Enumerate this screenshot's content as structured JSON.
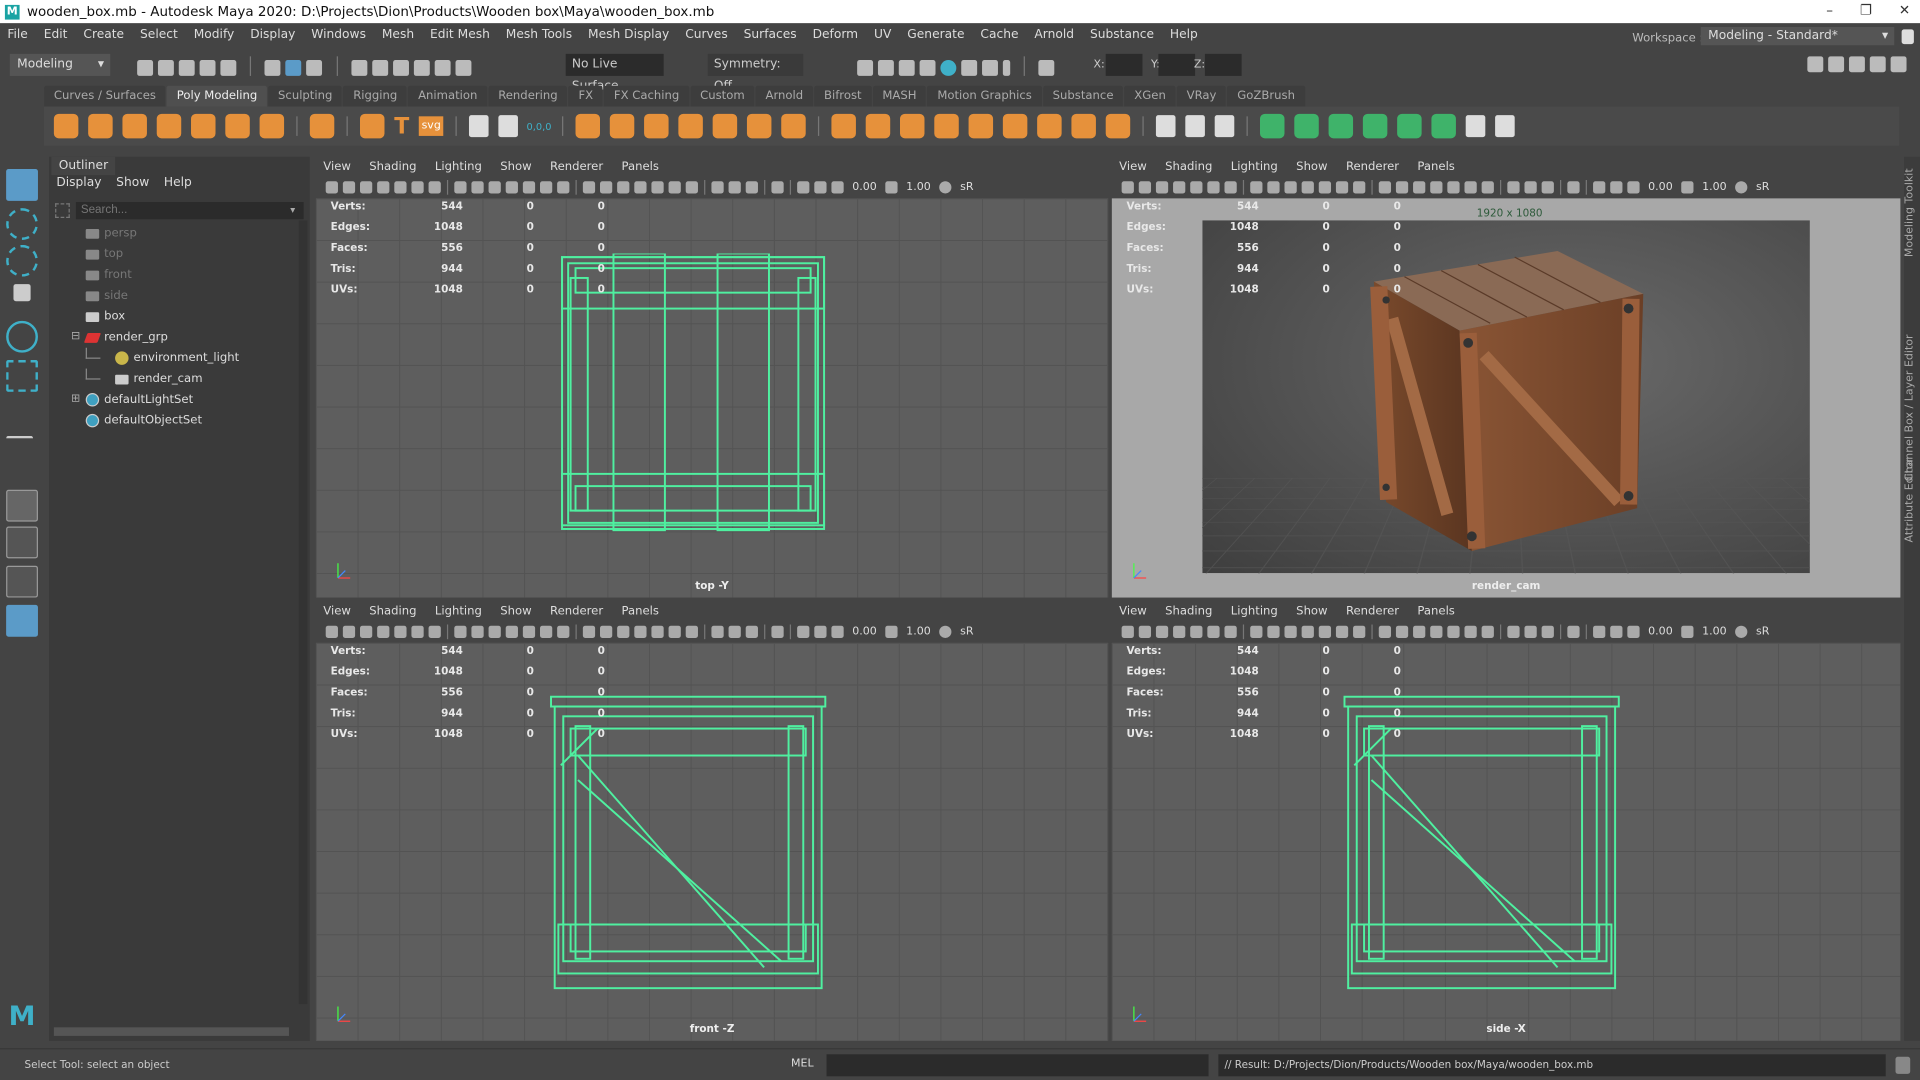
{
  "window": {
    "title": "wooden_box.mb - Autodesk Maya 2020: D:\\Projects\\Dion\\Products\\Wooden box\\Maya\\wooden_box.mb",
    "logo": "M",
    "minimize": "–",
    "maximize": "❐",
    "close": "✕"
  },
  "menu": [
    "File",
    "Edit",
    "Create",
    "Select",
    "Modify",
    "Display",
    "Windows",
    "Mesh",
    "Edit Mesh",
    "Mesh Tools",
    "Mesh Display",
    "Curves",
    "Surfaces",
    "Deform",
    "UV",
    "Generate",
    "Cache",
    "Arnold",
    "Substance",
    "Help"
  ],
  "statusline": {
    "menuset": "Modeling",
    "live_surface": "No Live Surface",
    "symmetry": "Symmetry: Off",
    "x_label": "X:",
    "y_label": "Y:",
    "z_label": "Z:",
    "workspace_label": "Workspace :",
    "workspace": "Modeling - Standard*"
  },
  "shelf_tabs": [
    "Curves / Surfaces",
    "Poly Modeling",
    "Sculpting",
    "Rigging",
    "Animation",
    "Rendering",
    "FX",
    "FX Caching",
    "Custom",
    "Arnold",
    "Bifrost",
    "MASH",
    "Motion Graphics",
    "Substance",
    "XGen",
    "VRay",
    "GoZBrush"
  ],
  "shelf_active": "Poly Modeling",
  "shelf_labels": {
    "text": "T",
    "svg": "svg",
    "origin": "0,0,0"
  },
  "outliner": {
    "tab": "Outliner",
    "menu": [
      "Display",
      "Show",
      "Help"
    ],
    "search_placeholder": "Search...",
    "items": [
      {
        "label": "persp",
        "icon": "camera-icon",
        "dim": true
      },
      {
        "label": "top",
        "icon": "camera-icon",
        "dim": true
      },
      {
        "label": "front",
        "icon": "camera-icon",
        "dim": true
      },
      {
        "label": "side",
        "icon": "camera-icon",
        "dim": true
      },
      {
        "label": "box",
        "icon": "mesh-icon",
        "dim": false
      },
      {
        "label": "render_grp",
        "icon": "group-icon",
        "dim": false,
        "expander": "⊟"
      },
      {
        "label": "environment_light",
        "icon": "light-icon",
        "dim": false,
        "child": true
      },
      {
        "label": "render_cam",
        "icon": "camera-icon",
        "dim": false,
        "child": true
      },
      {
        "label": "defaultLightSet",
        "icon": "set-icon",
        "dim": false,
        "expander": "⊞"
      },
      {
        "label": "defaultObjectSet",
        "icon": "set-icon",
        "dim": false
      }
    ]
  },
  "viewport_menu": [
    "View",
    "Shading",
    "Lighting",
    "Show",
    "Renderer",
    "Panels"
  ],
  "viewport_toolbar": {
    "exposure": "0.00",
    "gamma": "1.00",
    "colorspace": "sR"
  },
  "hud": {
    "rows": [
      {
        "label": "Verts:",
        "v": "544",
        "a": "0",
        "b": "0"
      },
      {
        "label": "Edges:",
        "v": "1048",
        "a": "0",
        "b": "0"
      },
      {
        "label": "Faces:",
        "v": "556",
        "a": "0",
        "b": "0"
      },
      {
        "label": "Tris:",
        "v": "944",
        "a": "0",
        "b": "0"
      },
      {
        "label": "UVs:",
        "v": "1048",
        "a": "0",
        "b": "0"
      }
    ]
  },
  "viewports": [
    {
      "camera": "top -Y"
    },
    {
      "camera": "render_cam",
      "resolution": "1920 x 1080"
    },
    {
      "camera": "front -Z"
    },
    {
      "camera": "side -X"
    }
  ],
  "right_tabs": [
    "Modeling Toolkit",
    "Channel Box / Layer Editor",
    "Attribute Editor"
  ],
  "helpline": {
    "message": "Select Tool: select an object",
    "mel_label": "MEL",
    "mel_input": "",
    "result": "// Result: D:/Projects/Dion/Products/Wooden box/Maya/wooden_box.mb"
  },
  "colors": {
    "wire": "#4ff0a0",
    "accent": "#5b9bc8",
    "shelf_orange": "#e6913b"
  }
}
